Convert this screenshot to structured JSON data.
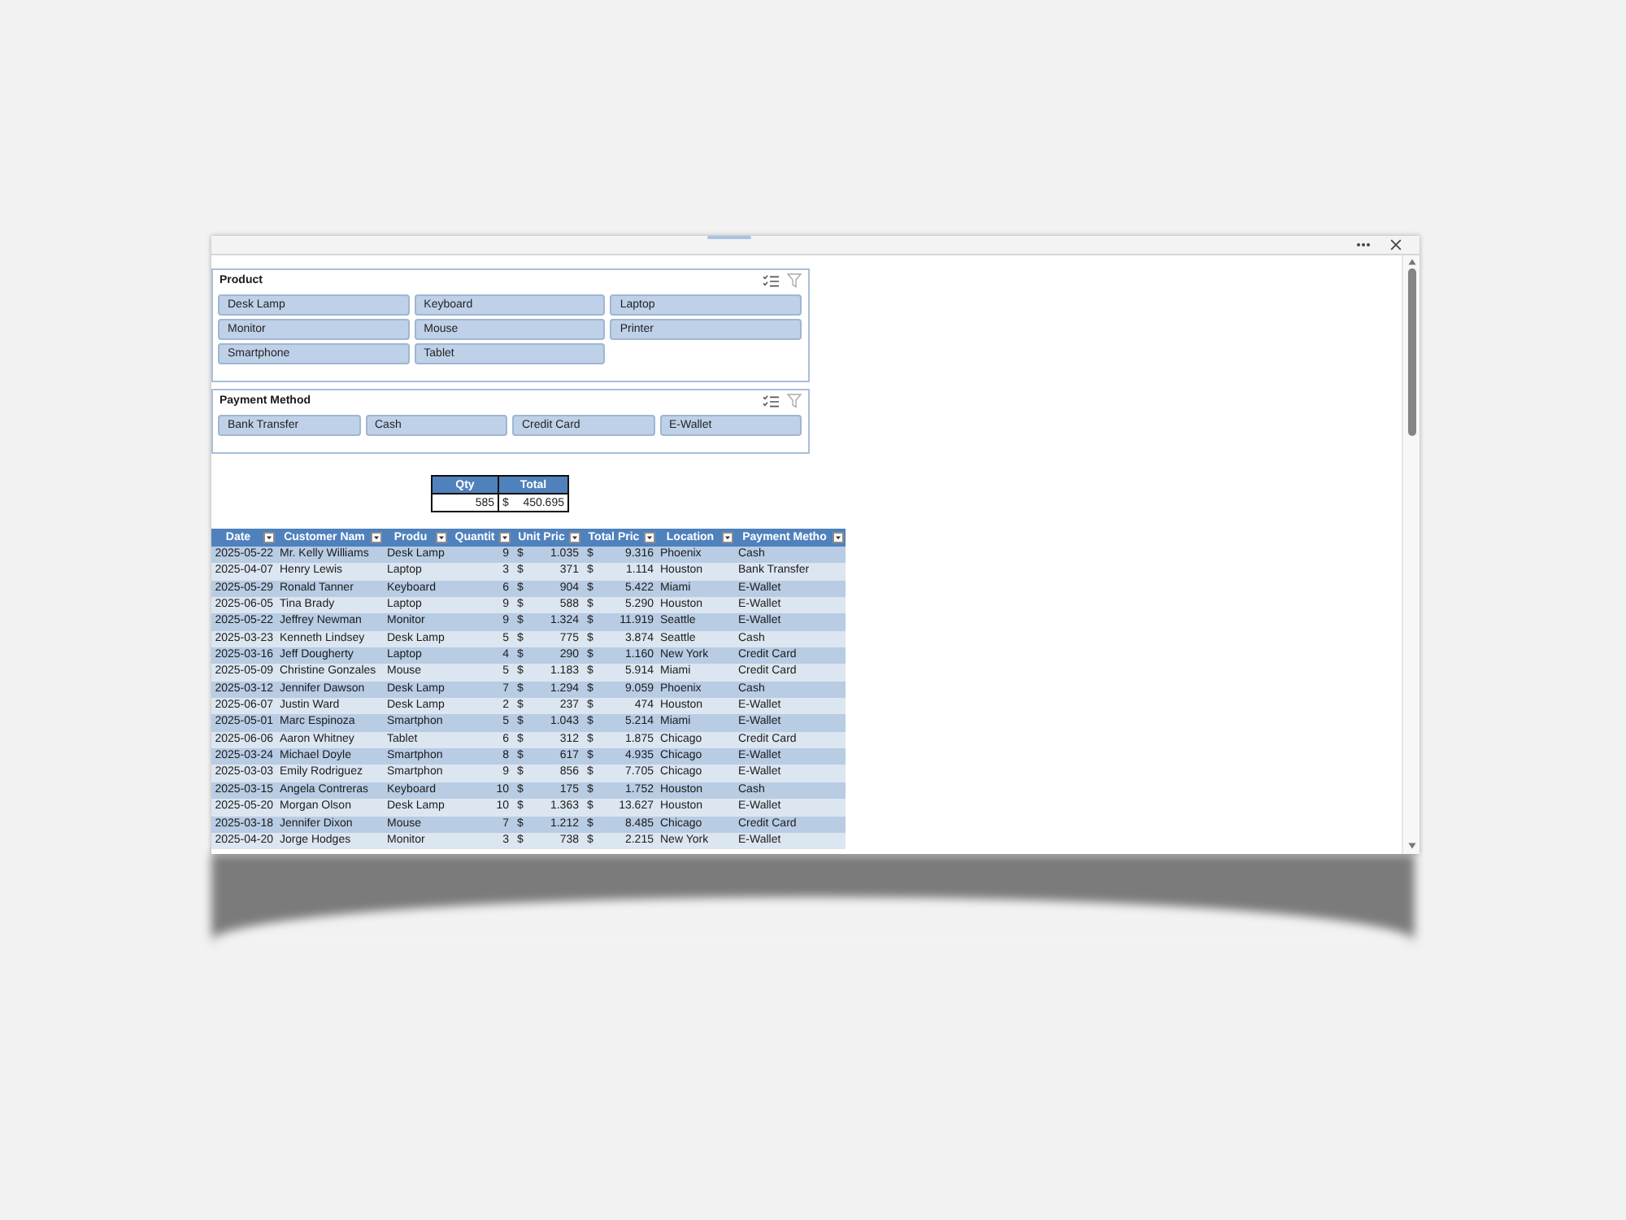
{
  "slicers": [
    {
      "title": "Product",
      "items": [
        {
          "label": "Desk Lamp",
          "selected": true
        },
        {
          "label": "Keyboard",
          "selected": true
        },
        {
          "label": "Laptop",
          "selected": true
        },
        {
          "label": "Monitor",
          "selected": true
        },
        {
          "label": "Mouse",
          "selected": true
        },
        {
          "label": "Printer",
          "selected": true
        },
        {
          "label": "Smartphone",
          "selected": true
        },
        {
          "label": "Tablet",
          "selected": true
        }
      ]
    },
    {
      "title": "Payment Method",
      "items": [
        {
          "label": "Bank Transfer",
          "selected": true
        },
        {
          "label": "Cash",
          "selected": true
        },
        {
          "label": "Credit Card",
          "selected": true
        },
        {
          "label": "E-Wallet",
          "selected": true
        }
      ]
    }
  ],
  "summary": {
    "columns": [
      "Qty",
      "Total"
    ],
    "values": [
      {
        "amount": "585"
      },
      {
        "currency": "$",
        "amount": "450.695"
      }
    ]
  },
  "table": {
    "columns": [
      {
        "label": "Date",
        "kind": "date"
      },
      {
        "label": "Customer Nam",
        "kind": "text"
      },
      {
        "label": "Produ",
        "kind": "text"
      },
      {
        "label": "Quantit",
        "kind": "number"
      },
      {
        "label": "Unit Pric",
        "kind": "currency"
      },
      {
        "label": "Total Pric",
        "kind": "currency"
      },
      {
        "label": "Location",
        "kind": "text"
      },
      {
        "label": "Payment Metho",
        "kind": "text"
      }
    ],
    "rows": [
      [
        "2025-05-22",
        "Mr. Kelly Williams",
        "Desk Lamp",
        "9",
        {
          "currency": "$",
          "amount": "1.035"
        },
        {
          "currency": "$",
          "amount": "9.316"
        },
        "Phoenix",
        "Cash"
      ],
      [
        "2025-04-07",
        "Henry Lewis",
        "Laptop",
        "3",
        {
          "currency": "$",
          "amount": "371"
        },
        {
          "currency": "$",
          "amount": "1.114"
        },
        "Houston",
        "Bank Transfer"
      ],
      [
        "2025-05-29",
        "Ronald Tanner",
        "Keyboard",
        "6",
        {
          "currency": "$",
          "amount": "904"
        },
        {
          "currency": "$",
          "amount": "5.422"
        },
        "Miami",
        "E-Wallet"
      ],
      [
        "2025-06-05",
        "Tina Brady",
        "Laptop",
        "9",
        {
          "currency": "$",
          "amount": "588"
        },
        {
          "currency": "$",
          "amount": "5.290"
        },
        "Houston",
        "E-Wallet"
      ],
      [
        "2025-05-22",
        "Jeffrey Newman",
        "Monitor",
        "9",
        {
          "currency": "$",
          "amount": "1.324"
        },
        {
          "currency": "$",
          "amount": "11.919"
        },
        "Seattle",
        "E-Wallet"
      ],
      [
        "2025-03-23",
        "Kenneth Lindsey",
        "Desk Lamp",
        "5",
        {
          "currency": "$",
          "amount": "775"
        },
        {
          "currency": "$",
          "amount": "3.874"
        },
        "Seattle",
        "Cash"
      ],
      [
        "2025-03-16",
        "Jeff Dougherty",
        "Laptop",
        "4",
        {
          "currency": "$",
          "amount": "290"
        },
        {
          "currency": "$",
          "amount": "1.160"
        },
        "New York",
        "Credit Card"
      ],
      [
        "2025-05-09",
        "Christine Gonzales",
        "Mouse",
        "5",
        {
          "currency": "$",
          "amount": "1.183"
        },
        {
          "currency": "$",
          "amount": "5.914"
        },
        "Miami",
        "Credit Card"
      ],
      [
        "2025-03-12",
        "Jennifer Dawson",
        "Desk Lamp",
        "7",
        {
          "currency": "$",
          "amount": "1.294"
        },
        {
          "currency": "$",
          "amount": "9.059"
        },
        "Phoenix",
        "Cash"
      ],
      [
        "2025-06-07",
        "Justin Ward",
        "Desk Lamp",
        "2",
        {
          "currency": "$",
          "amount": "237"
        },
        {
          "currency": "$",
          "amount": "474"
        },
        "Houston",
        "E-Wallet"
      ],
      [
        "2025-05-01",
        "Marc Espinoza",
        "Smartphon",
        "5",
        {
          "currency": "$",
          "amount": "1.043"
        },
        {
          "currency": "$",
          "amount": "5.214"
        },
        "Miami",
        "E-Wallet"
      ],
      [
        "2025-06-06",
        "Aaron Whitney",
        "Tablet",
        "6",
        {
          "currency": "$",
          "amount": "312"
        },
        {
          "currency": "$",
          "amount": "1.875"
        },
        "Chicago",
        "Credit Card"
      ],
      [
        "2025-03-24",
        "Michael Doyle",
        "Smartphon",
        "8",
        {
          "currency": "$",
          "amount": "617"
        },
        {
          "currency": "$",
          "amount": "4.935"
        },
        "Chicago",
        "E-Wallet"
      ],
      [
        "2025-03-03",
        "Emily Rodriguez",
        "Smartphon",
        "9",
        {
          "currency": "$",
          "amount": "856"
        },
        {
          "currency": "$",
          "amount": "7.705"
        },
        "Chicago",
        "E-Wallet"
      ],
      [
        "2025-03-15",
        "Angela Contreras",
        "Keyboard",
        "10",
        {
          "currency": "$",
          "amount": "175"
        },
        {
          "currency": "$",
          "amount": "1.752"
        },
        "Houston",
        "Cash"
      ],
      [
        "2025-05-20",
        "Morgan Olson",
        "Desk Lamp",
        "10",
        {
          "currency": "$",
          "amount": "1.363"
        },
        {
          "currency": "$",
          "amount": "13.627"
        },
        "Houston",
        "E-Wallet"
      ],
      [
        "2025-03-18",
        "Jennifer Dixon",
        "Mouse",
        "7",
        {
          "currency": "$",
          "amount": "1.212"
        },
        {
          "currency": "$",
          "amount": "8.485"
        },
        "Chicago",
        "Credit Card"
      ],
      [
        "2025-04-20",
        "Jorge Hodges",
        "Monitor",
        "3",
        {
          "currency": "$",
          "amount": "738"
        },
        {
          "currency": "$",
          "amount": "2.215"
        },
        "New York",
        "E-Wallet"
      ]
    ]
  }
}
